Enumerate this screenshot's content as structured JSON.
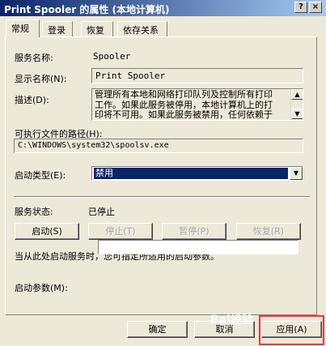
{
  "window": {
    "title": "Print Spooler 的属性 (本地计算机)",
    "help_btn": "?",
    "close_btn": "×"
  },
  "tabs": [
    {
      "label": "常规",
      "active": true
    },
    {
      "label": "登录",
      "active": false
    },
    {
      "label": "恢复",
      "active": false
    },
    {
      "label": "依存关系",
      "active": false
    }
  ],
  "general": {
    "service_name_label": "服务名称:",
    "service_name": "Spooler",
    "display_name_label": "显示名称(N):",
    "display_name": "Print Spooler",
    "description_label": "描述(D):",
    "description_lines": [
      "管理所有本地和网络打印队列及控制所有打印",
      "工作。如果此服务被停用，本地计算机上的打",
      "印将不可用。如果此服务被禁用，任何依赖于"
    ],
    "exe_path_label": "可执行文件的路径(H):",
    "exe_path": "C:\\WINDOWS\\system32\\spoolsv.exe",
    "startup_type_label": "启动类型(E):",
    "startup_type": "禁用",
    "service_status_label": "服务状态:",
    "service_status": "已停止",
    "start_button": "启动(S)",
    "stop_button": "停止(T)",
    "pause_button": "暂停(P)",
    "resume_button": "恢复(R)",
    "hint_text": "当从此处启动服务时，您可指定所适用的启动参数。",
    "start_params_label": "启动参数(M):",
    "start_params_value": ""
  },
  "footer": {
    "ok_button": "确定",
    "cancel_button": "取消",
    "apply_button": "应用(A)"
  },
  "watermark": "Bai经验",
  "colors": {
    "titlebar_start": "#0a246a",
    "titlebar_end": "#a6caf0",
    "highlight_box": "#ff3333",
    "selection": "#0a246a"
  }
}
